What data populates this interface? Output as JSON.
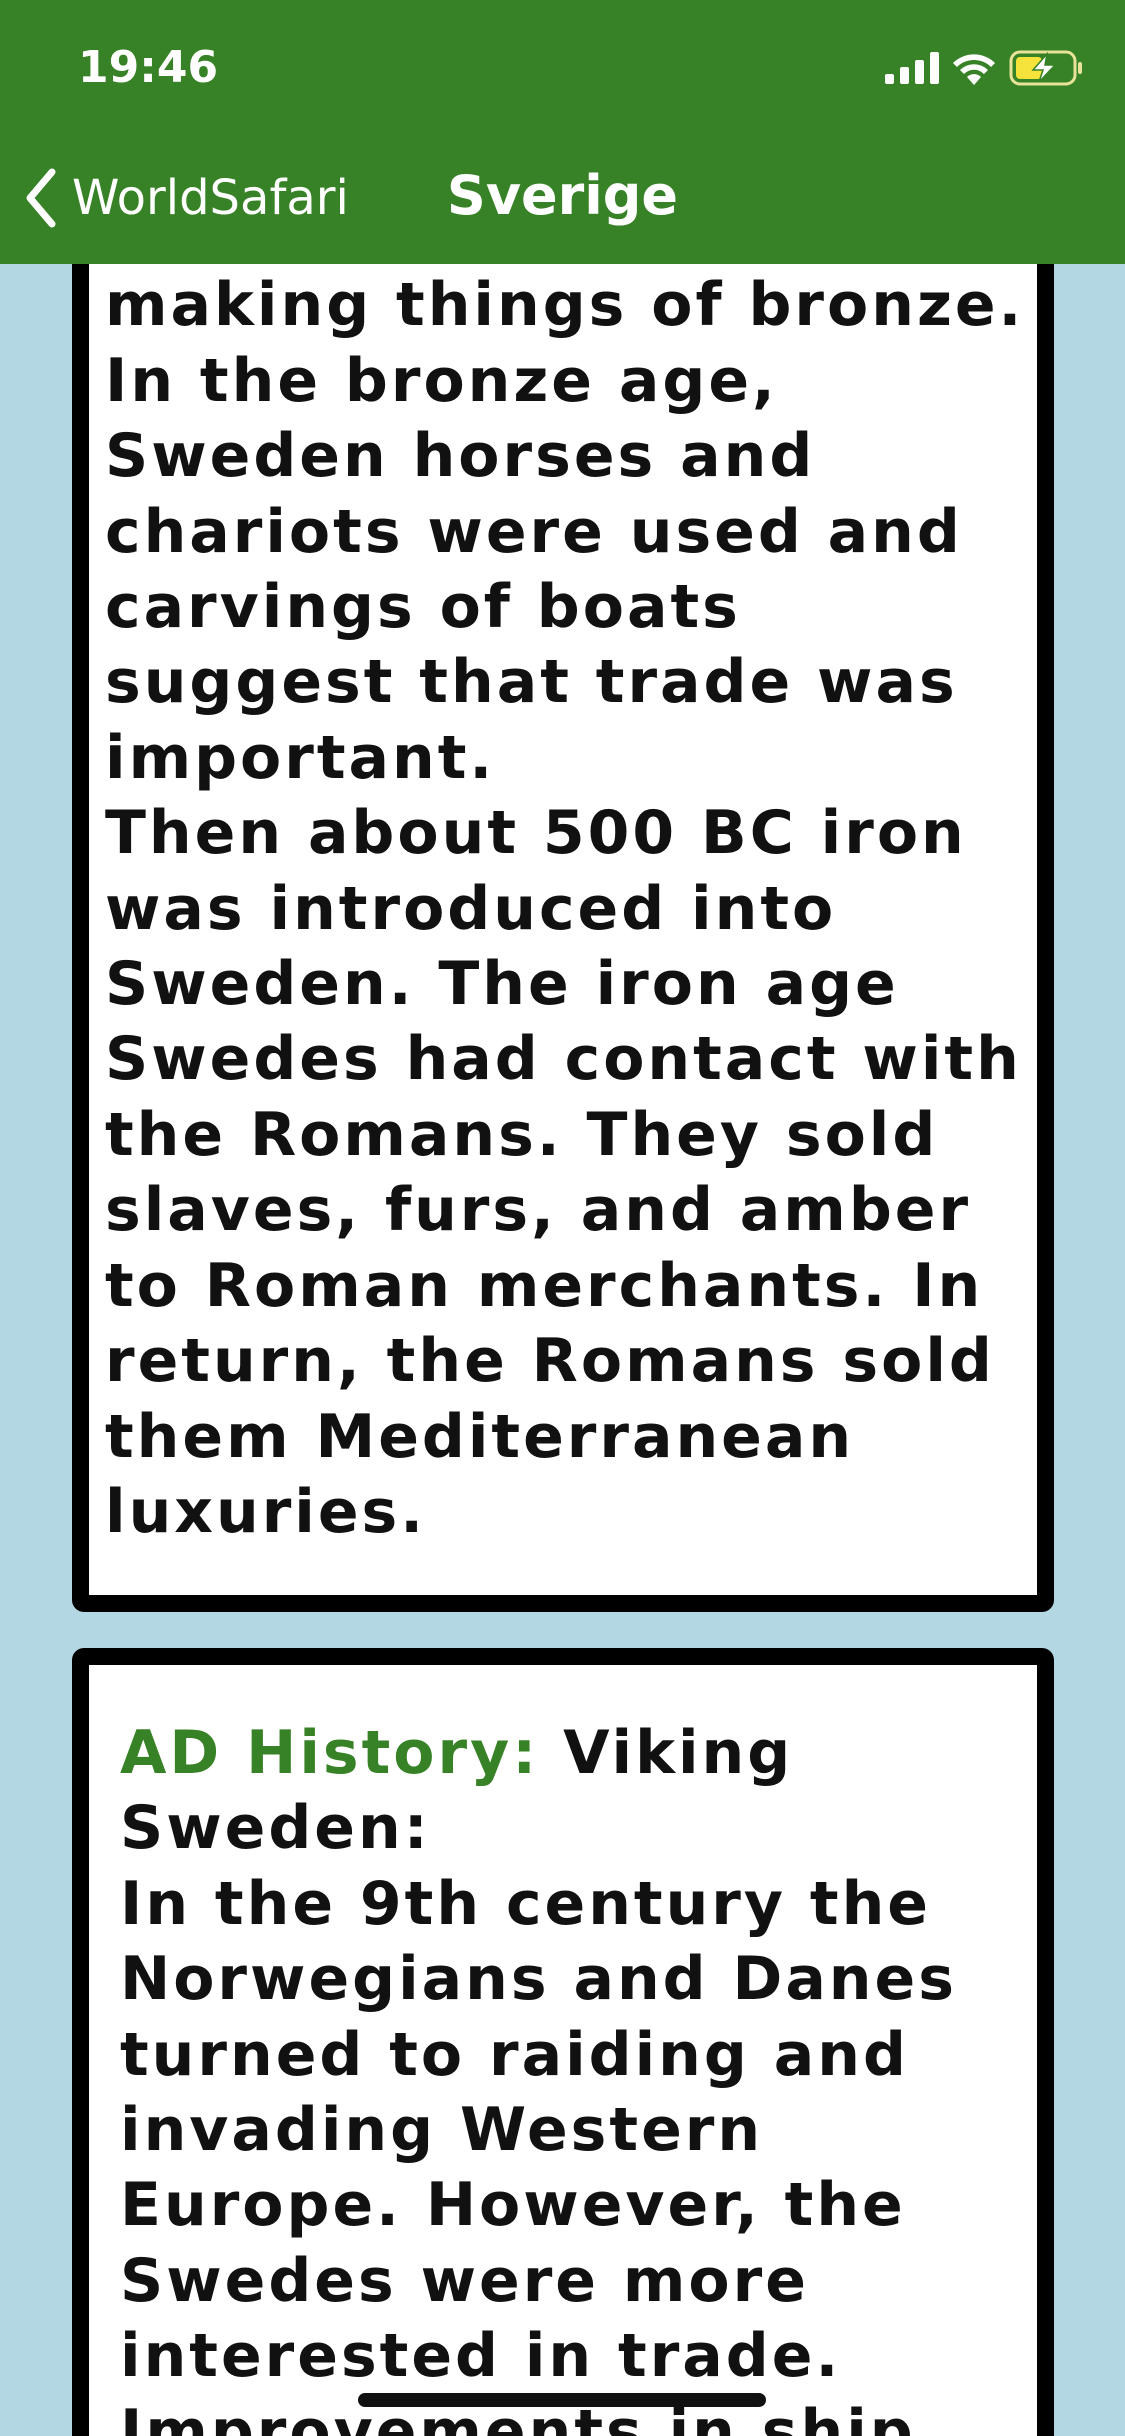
{
  "status_bar": {
    "time": "19:46",
    "icons": [
      "cellular-signal-icon",
      "wifi-icon",
      "battery-charging-icon"
    ]
  },
  "nav": {
    "back_label": "WorldSafari",
    "title": "Sverige"
  },
  "cards": [
    {
      "text": "became very skilled at\nmaking things of bronze.\nIn the bronze age,\nSweden horses and\nchariots were used and\ncarvings of boats\nsuggest that trade was\nimportant.\nThen about 500 BC iron\nwas introduced into\nSweden. The iron age\nSwedes had contact with\nthe Romans. They sold\nslaves, furs, and amber\nto Roman merchants. In\nreturn, the Romans sold\nthem Mediterranean\nluxuries."
    },
    {
      "heading": "AD History:",
      "text": " Viking\nSweden:\nIn the 9th century the\nNorwegians and Danes\nturned to raiding and\ninvading Western\nEurope. However, the\nSwedes were more\ninterested in trade.\nImprovements in ship"
    }
  ],
  "colors": {
    "header": "#378226",
    "background": "#b4d8e3",
    "accent": "#378226",
    "card_border": "#000000"
  }
}
